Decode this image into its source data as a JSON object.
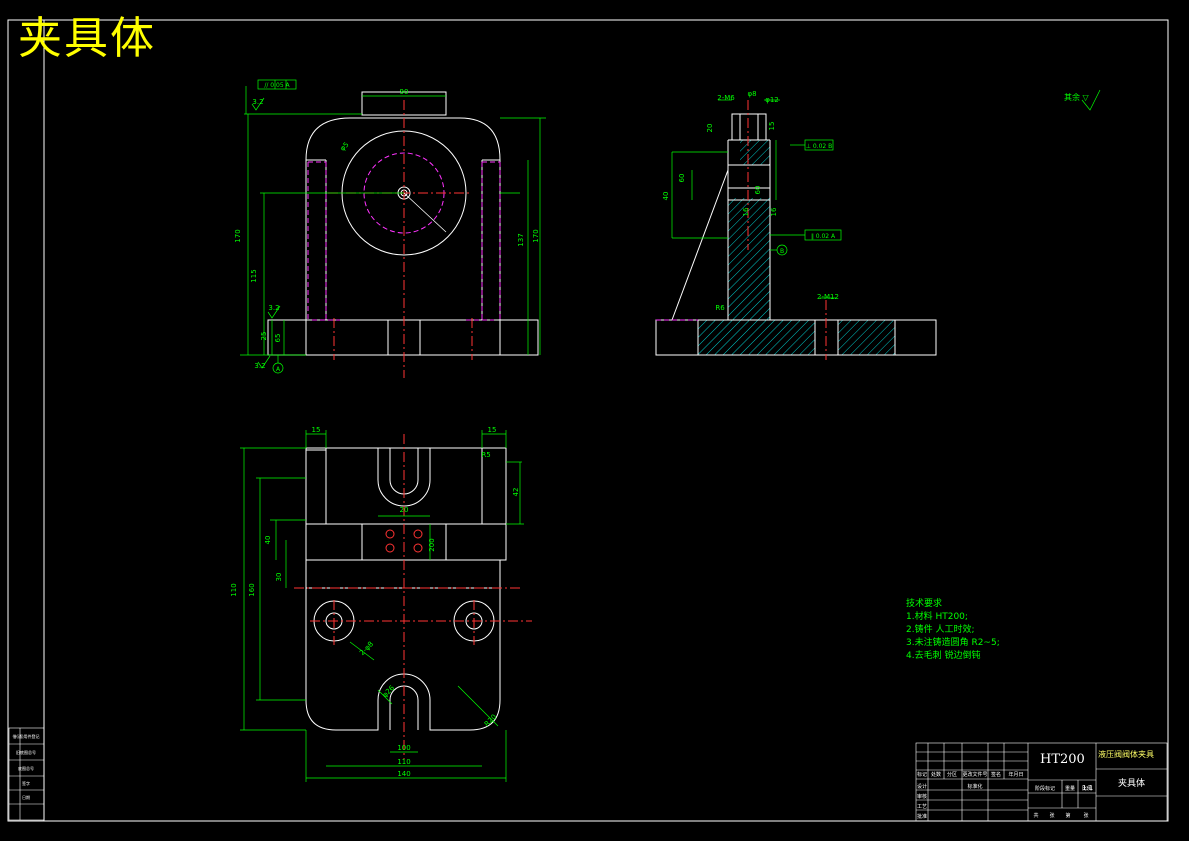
{
  "drawing": {
    "title": "夹具体",
    "material": "HT200",
    "part_name": "夹具体",
    "technical_requirements": {
      "heading": "技术要求",
      "items": [
        "1.材料 HT200;",
        "2.铸件 人工时效;",
        "3.未注铸造圆角 R2~5;",
        "4.去毛刺 锐边倒钝"
      ]
    },
    "roughness_symbol": "其余 ▽"
  },
  "dimensions": {
    "front": [
      "90",
      "φ5",
      "170",
      "115",
      "137",
      "170",
      "25",
      "65",
      "3.2",
      "3.2",
      "3.2"
    ],
    "side": [
      "2-M6",
      "φ8",
      "φ12",
      "20",
      "15",
      "40",
      "60",
      "60",
      "16",
      "16",
      "2-M12",
      "R6"
    ],
    "top": [
      "15",
      "15",
      "R5",
      "42",
      "20",
      "40",
      "30",
      "110",
      "160",
      "200",
      "φ26",
      "2-φ8",
      "R20",
      "100",
      "110",
      "140"
    ]
  },
  "tolerance_frames": {
    "front_top": "// 0.05 A",
    "side_1": "⊥ 0.02 B",
    "side_2": "∥ 0.02 A"
  },
  "datums": [
    "A",
    "B"
  ],
  "title_block": {
    "labels": [
      "标记",
      "处数",
      "分区",
      "更改文件号",
      "签名",
      "年月日",
      "设计",
      "标准化",
      "审核",
      "工艺",
      "批准",
      "阶段标记",
      "重量",
      "比例",
      "共",
      "张",
      "第",
      "张"
    ],
    "scale": "1:1",
    "org": "液压阀阀体夹具"
  },
  "side_table": {
    "labels": [
      "借(通)用件登记",
      "旧底图总号",
      "底图总号",
      "签字",
      "日期"
    ]
  }
}
